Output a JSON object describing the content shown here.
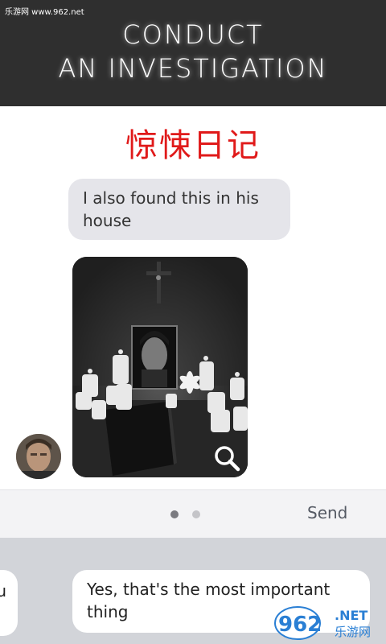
{
  "header": {
    "watermark": "乐游网 www.962.net",
    "title_line1": "CONDUCT",
    "title_line2": "AN INVESTIGATION"
  },
  "chat": {
    "app_name": "惊悚日记",
    "incoming_message": "I also found this in his house",
    "photo_icon": "magnifier-icon",
    "avatar_icon": "contact-avatar"
  },
  "composer": {
    "send_label": "Send",
    "page_dots": [
      true,
      false
    ]
  },
  "replies": {
    "partial_option": "u",
    "option_main": "Yes, that's the most important thing"
  },
  "logo": {
    "text_main": "962",
    "text_net": ".NET",
    "text_cn": "乐游网"
  },
  "colors": {
    "header_bg": "#2f2f2f",
    "app_name_red": "#e01a1a",
    "bubble_gray": "#e5e5ea",
    "reply_area": "#d2d4d9",
    "send_text": "#555a64"
  }
}
